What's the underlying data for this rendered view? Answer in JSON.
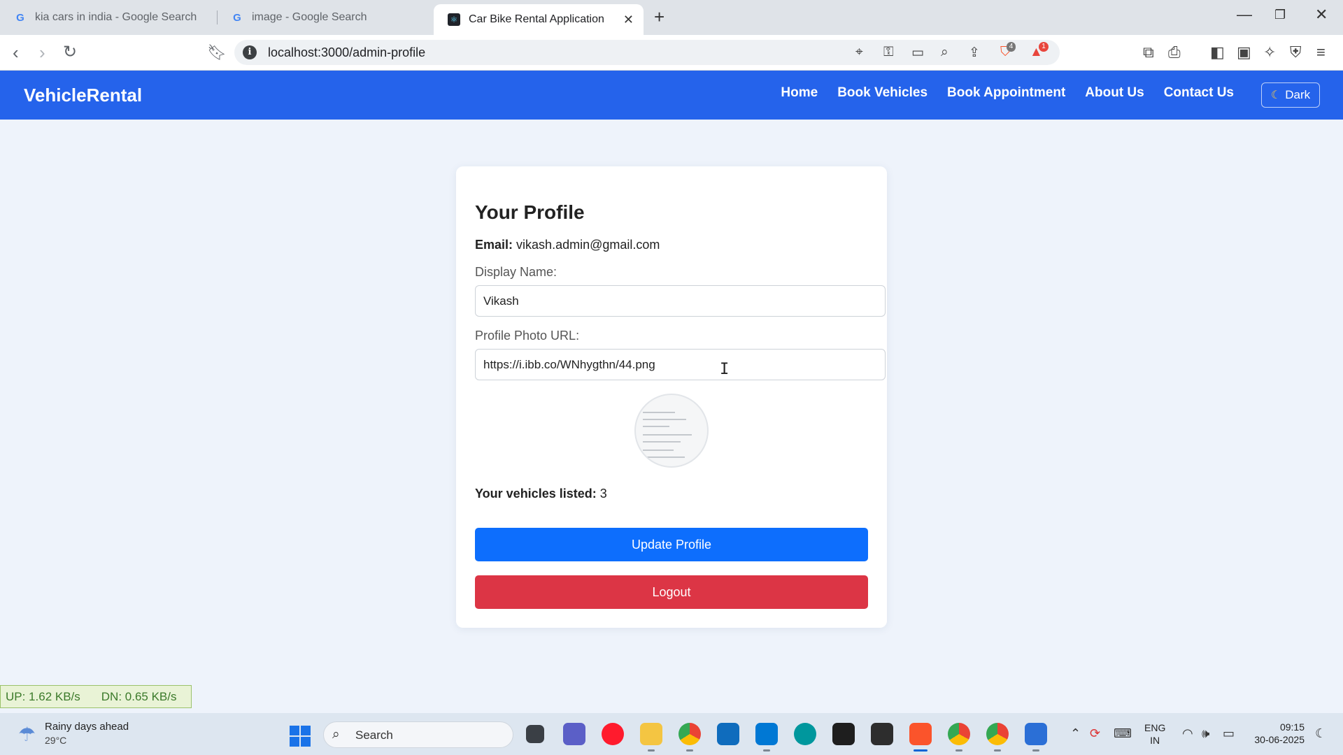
{
  "browser": {
    "tabs": [
      {
        "title": "kia cars in india - Google Search",
        "favicon": "google-g-icon",
        "active": false
      },
      {
        "title": "image - Google Search",
        "favicon": "google-g-icon",
        "active": false
      },
      {
        "title": "Car Bike Rental Application",
        "favicon": "react-icon",
        "active": true
      }
    ],
    "url": "localhost:3000/admin-profile",
    "shields_badge": "4",
    "rewards_badge": "1"
  },
  "app": {
    "brand": "VehicleRental",
    "nav": [
      "Home",
      "Book Vehicles",
      "Book Appointment",
      "About Us",
      "Contact Us"
    ],
    "theme_toggle": "Dark",
    "accent": "#2563eb"
  },
  "profile": {
    "heading": "Your Profile",
    "email_label": "Email:",
    "email": "vikash.admin@gmail.com",
    "display_name_label": "Display Name:",
    "display_name_value": "Vikash",
    "photo_url_label": "Profile Photo URL:",
    "photo_url_value": "https://i.ibb.co/WNhygthn/44.png",
    "vehicles_label": "Your vehicles listed:",
    "vehicles_count": "3",
    "update_button": "Update Profile",
    "logout_button": "Logout",
    "update_color": "#0d6efd",
    "logout_color": "#dc3545"
  },
  "netmeter": {
    "up": "UP: 1.62 KB/s",
    "down": "DN: 0.65 KB/s"
  },
  "taskbar": {
    "weather_title": "Rainy days ahead",
    "weather_temp": "29°C",
    "search_label": "Search",
    "lang_line1": "ENG",
    "lang_line2": "IN",
    "time": "09:15",
    "date": "30-06-2025"
  }
}
